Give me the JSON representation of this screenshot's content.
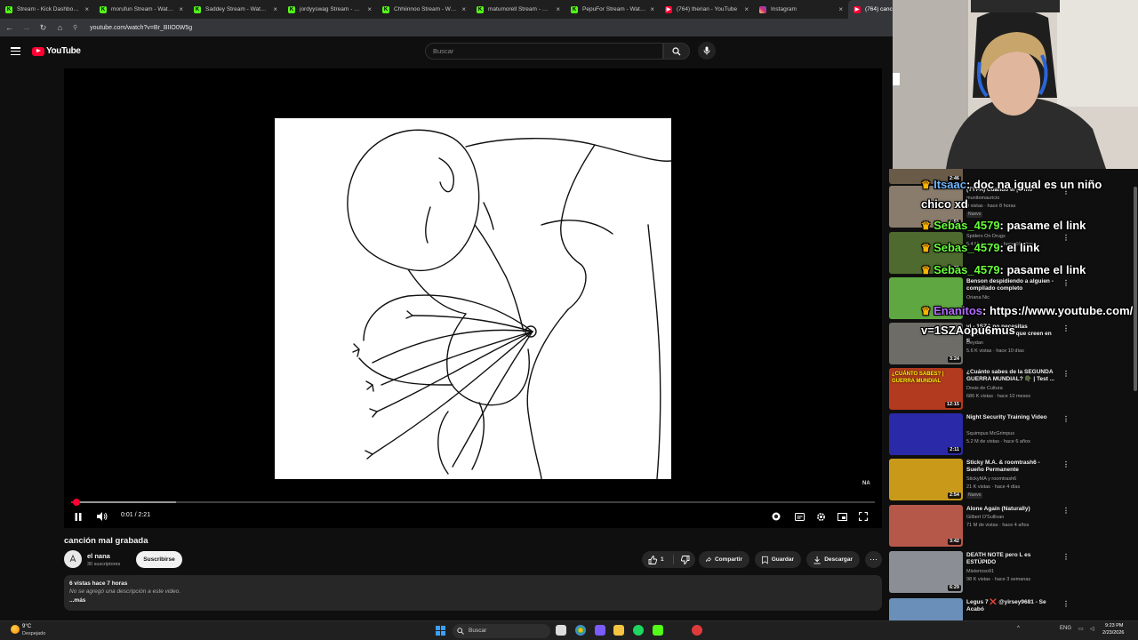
{
  "browser": {
    "tabs": [
      {
        "label": "Stream - Kick Dashboard",
        "icon": "kick-icon",
        "active": false
      },
      {
        "label": "morufun Stream - Watch L",
        "icon": "kick-icon",
        "active": false
      },
      {
        "label": "Saddey Stream - Watch Li",
        "icon": "kick-icon",
        "active": false
      },
      {
        "label": "jordyyswag Stream - Watc",
        "icon": "kick-icon",
        "active": false
      },
      {
        "label": "Chhiinnoo Stream - Watc",
        "icon": "kick-icon",
        "active": false
      },
      {
        "label": "matumorell Stream - Wat",
        "icon": "kick-icon",
        "active": false
      },
      {
        "label": "PepuFor Stream - Watch L",
        "icon": "kick-icon",
        "active": false
      },
      {
        "label": "(764) therian - YouTube",
        "icon": "youtube-icon",
        "active": false
      },
      {
        "label": "Instagram",
        "icon": "instagram-icon",
        "active": false
      },
      {
        "label": "(764) canc",
        "icon": "youtube-icon",
        "active": true
      }
    ],
    "url": "youtube.com/watch?v=Br_BIIO0W5g"
  },
  "masthead": {
    "logo_text": "YouTube",
    "search_placeholder": "Buscar"
  },
  "player": {
    "time": "0:01 / 2:21",
    "progress": 0.007,
    "buffered": 0.13,
    "na_badge": "NA"
  },
  "video": {
    "title": "canción mal grabada",
    "channel_name": "el nana",
    "subscribers": "30 suscriptores",
    "subscribe_label": "Suscribirse",
    "like_count": "1",
    "share_label": "Compartir",
    "save_label": "Guardar",
    "download_label": "Descargar",
    "desc_stats": "6 vistas  hace 7 horas",
    "desc_text": "No se agregó una descripción a este video.",
    "desc_more": "...más"
  },
  "recommendations": [
    {
      "title": "",
      "channel": "",
      "meta": "4 M de vistas · hace 4 años",
      "duration": "2:46",
      "badge": "",
      "thumb_color": "#6a5a48",
      "partial": true
    },
    {
      "title": "(TYPA) Cuando el primo",
      "channel": "munitomauricio",
      "meta": "9 vistas · hace 8 horas",
      "duration": "1:51",
      "badge": "Nuevo",
      "thumb_color": "#8a7c6c"
    },
    {
      "title": "",
      "channel": "Spiders On Drugs",
      "meta": "5.4 M de vistas · hace 16 años",
      "duration": "1:35",
      "badge": "",
      "thumb_color": "#4e6a2e"
    },
    {
      "title": "Benson despidiendo a alguien - compilado completo",
      "channel": "Oriana Nic",
      "meta": "",
      "duration": "",
      "badge": "",
      "thumb_color": "#5fa841"
    },
    {
      "title": "vi - 1SZA no necesitas impresionar a los que creen en ti",
      "channel": "Deydan",
      "meta": "5.6 K vistas · hace 10 días",
      "duration": "3:24",
      "badge": "",
      "thumb_color": "#6e6c66"
    },
    {
      "title": "¿Cuánto sabes de la SEGUNDA GUERRA MUNDIAL? 🪖 | Test ...",
      "channel": "Dosis de Cultura",
      "meta": "686 K vistas · hace 10 meses",
      "duration": "12:15",
      "badge": "",
      "thumb_color": "#b23a1e",
      "thumb_text": "¿CUÁNTO SABES? | GUERRA MUNDIAL"
    },
    {
      "title": "Night Security Training Video",
      "channel": "Squimpus McGrimpus",
      "meta": "5.2 M de vistas · hace 6 años",
      "duration": "2:11",
      "badge": "",
      "thumb_color": "#2a2aa8"
    },
    {
      "title": "Sticky M.A. & roomtrash6 - Sueño Permanente",
      "channel": "StickyMA  y roomtrash6",
      "meta": "21 K vistas · hace 4 días",
      "duration": "2:54",
      "badge": "Nuevo",
      "thumb_color": "#c99a1a"
    },
    {
      "title": "Alone Again (Naturally)",
      "channel": "Gilbert O'Sullivan",
      "meta": "71 M de vistas · hace 4 años",
      "duration": "3:42",
      "badge": "",
      "thumb_color": "#b5584a"
    },
    {
      "title": "DEATH NOTE pero L es ESTÚPIDO",
      "channel": "Misterioso91",
      "meta": "98 K vistas · hace 3 semanas",
      "duration": "6:29",
      "badge": "",
      "thumb_color": "#8b8f95"
    },
    {
      "title": "Legus 7 ❌ @yirsey9681 - Se Acabó",
      "channel": "",
      "meta": "",
      "duration": "",
      "badge": "",
      "thumb_color": "#6a8fb8",
      "partial": true
    }
  ],
  "chat": [
    {
      "user": "Itsaac",
      "text": ": doc na igual es un niño",
      "user_color": "blue"
    },
    {
      "user": "",
      "text": "chico xd",
      "user_color": ""
    },
    {
      "user": "Sebas_4579",
      "text": ": pasame el link",
      "user_color": "green"
    },
    {
      "user": "Sebas_4579",
      "text": ": el link",
      "user_color": "green"
    },
    {
      "user": "Sebas_4579",
      "text": ": pasame el link",
      "user_color": "green"
    },
    {
      "user": "Enanitos",
      "text": ": https://www.youtube.com/",
      "user_color": "purple"
    },
    {
      "user": "",
      "text": "v=1SZAopu6mus",
      "user_color": ""
    }
  ],
  "taskbar": {
    "temperature": "9°C",
    "weather": "Despejado",
    "search_label": "Buscar",
    "language": "ENG",
    "time": "9:23 PM",
    "date": "2/23/2026"
  }
}
